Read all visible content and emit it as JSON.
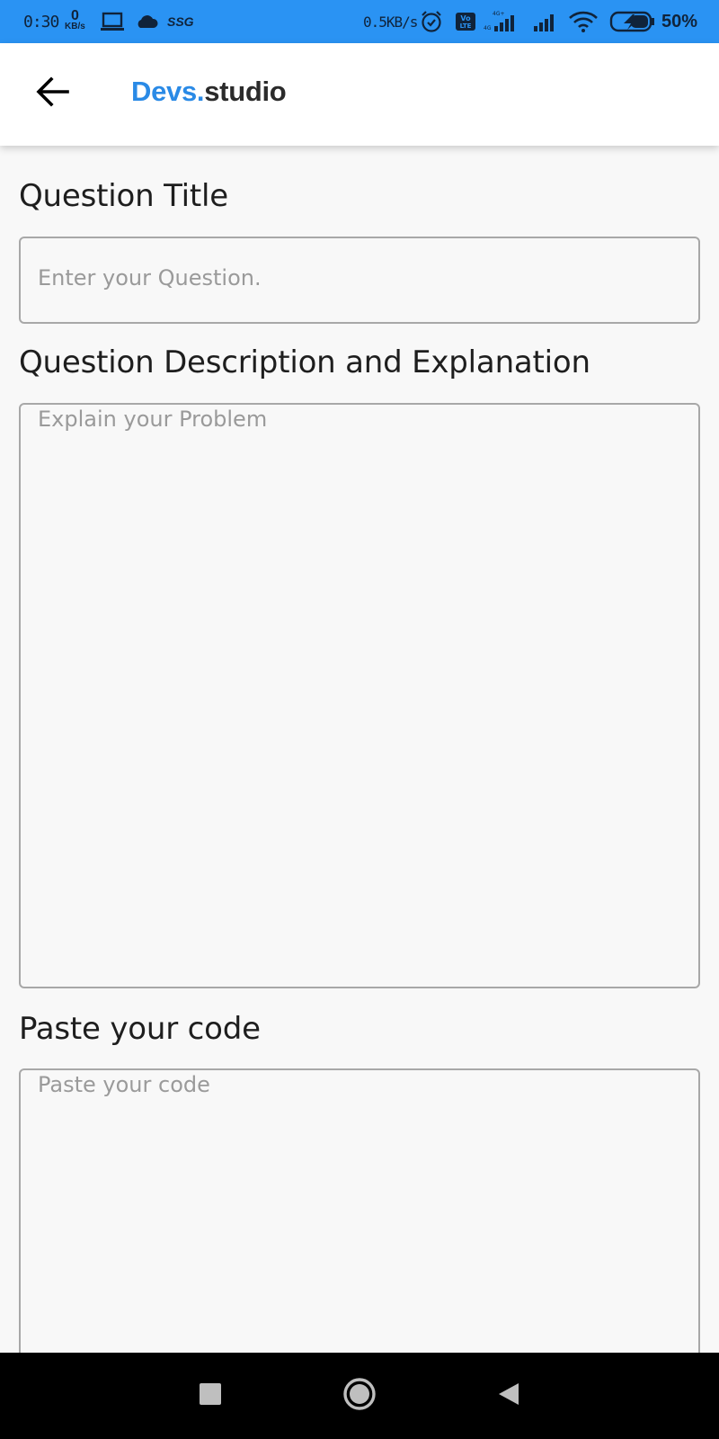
{
  "status_bar": {
    "time": "0:30",
    "data_rate_value": "0",
    "data_rate_unit": "KB/s",
    "carrier": "SSG",
    "network_speed": "0.5KB/s",
    "volte": "Vo LTE",
    "battery_percent": "50%"
  },
  "app_bar": {
    "brand_part1": "Devs.",
    "brand_part2": "studio"
  },
  "form": {
    "title_label": "Question Title",
    "title_placeholder": "Enter your Question.",
    "description_label": "Question Description and Explanation",
    "description_placeholder": "Explain your Problem",
    "code_label": "Paste your code",
    "code_placeholder": "Paste your code"
  },
  "icons": {
    "back": "arrow-left-icon",
    "recents": "square-icon",
    "home": "circle-icon",
    "nav_back": "triangle-left-icon"
  },
  "colors": {
    "status_bar": "#2a93f3",
    "brand_accent": "#2a8ae6",
    "page_background": "#f8f8f8",
    "field_border": "#a8a8a8"
  }
}
